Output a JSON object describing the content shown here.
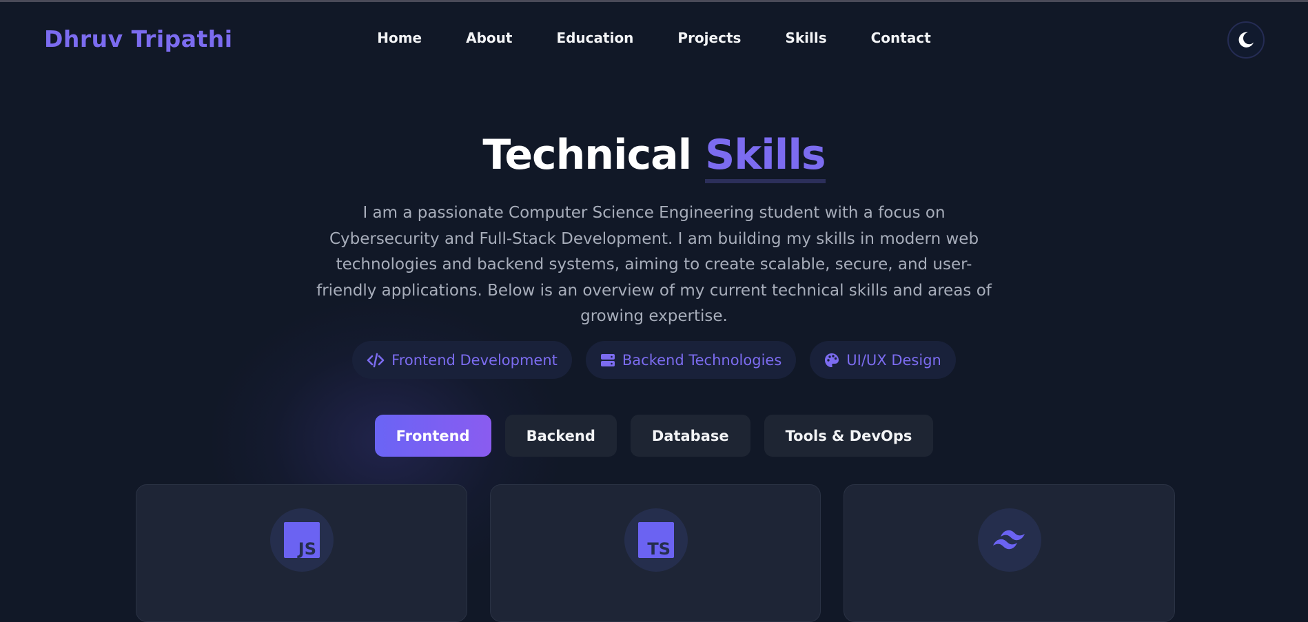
{
  "brand": {
    "name": "Dhruv Tripathi",
    "accent_color": "#7c6cf0"
  },
  "nav": {
    "links": [
      "Home",
      "About",
      "Education",
      "Projects",
      "Skills",
      "Contact"
    ],
    "theme_toggle_icon": "moon-icon"
  },
  "hero": {
    "title_main": "Technical",
    "title_accent": "Skills",
    "description": "I am a passionate Computer Science Engineering student with a focus on Cybersecurity and Full-Stack Development. I am building my skills in modern web technologies and backend systems, aiming to create scalable, secure, and user-friendly applications. Below is an overview of my current technical skills and areas of growing expertise."
  },
  "chips": [
    {
      "label": "Frontend Development",
      "icon": "code-icon"
    },
    {
      "label": "Backend Technologies",
      "icon": "server-icon"
    },
    {
      "label": "UI/UX Design",
      "icon": "palette-icon"
    }
  ],
  "tabs": [
    {
      "label": "Frontend",
      "active": true
    },
    {
      "label": "Backend",
      "active": false
    },
    {
      "label": "Database",
      "active": false
    },
    {
      "label": "Tools & DevOps",
      "active": false
    }
  ],
  "cards": [
    {
      "icon": "javascript-icon",
      "badge_text": "JS"
    },
    {
      "icon": "typescript-icon",
      "badge_text": "TS"
    },
    {
      "icon": "tailwind-icon"
    }
  ],
  "colors": {
    "background": "#111827",
    "card": "#1e2536",
    "tab": "#1e2533",
    "active_tab_gradient": [
      "#6a64f5",
      "#8a5cf0"
    ]
  }
}
